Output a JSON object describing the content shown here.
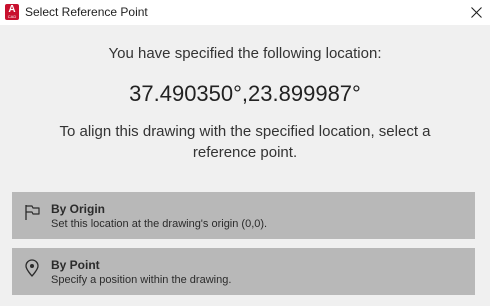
{
  "window": {
    "title": "Select Reference Point",
    "app_icon_letter": "A",
    "app_icon_sub": "CAD",
    "app_icon": "autocad-app-icon",
    "close_icon": "close-icon"
  },
  "dialog": {
    "intro": "You have specified the following location:",
    "coordinates": "37.490350°,23.899987°",
    "instruction": "To align this drawing with the specified location, select a reference point."
  },
  "options": [
    {
      "title": "By Origin",
      "description": "Set this location at the drawing's origin (0,0).",
      "icon": "flag-icon"
    },
    {
      "title": "By Point",
      "description": "Specify a position within the drawing.",
      "icon": "map-pin-icon"
    }
  ],
  "colors": {
    "app_icon_red": "#c8102e",
    "content_background": "#f0f0f0",
    "option_background": "#b8b8b8"
  }
}
